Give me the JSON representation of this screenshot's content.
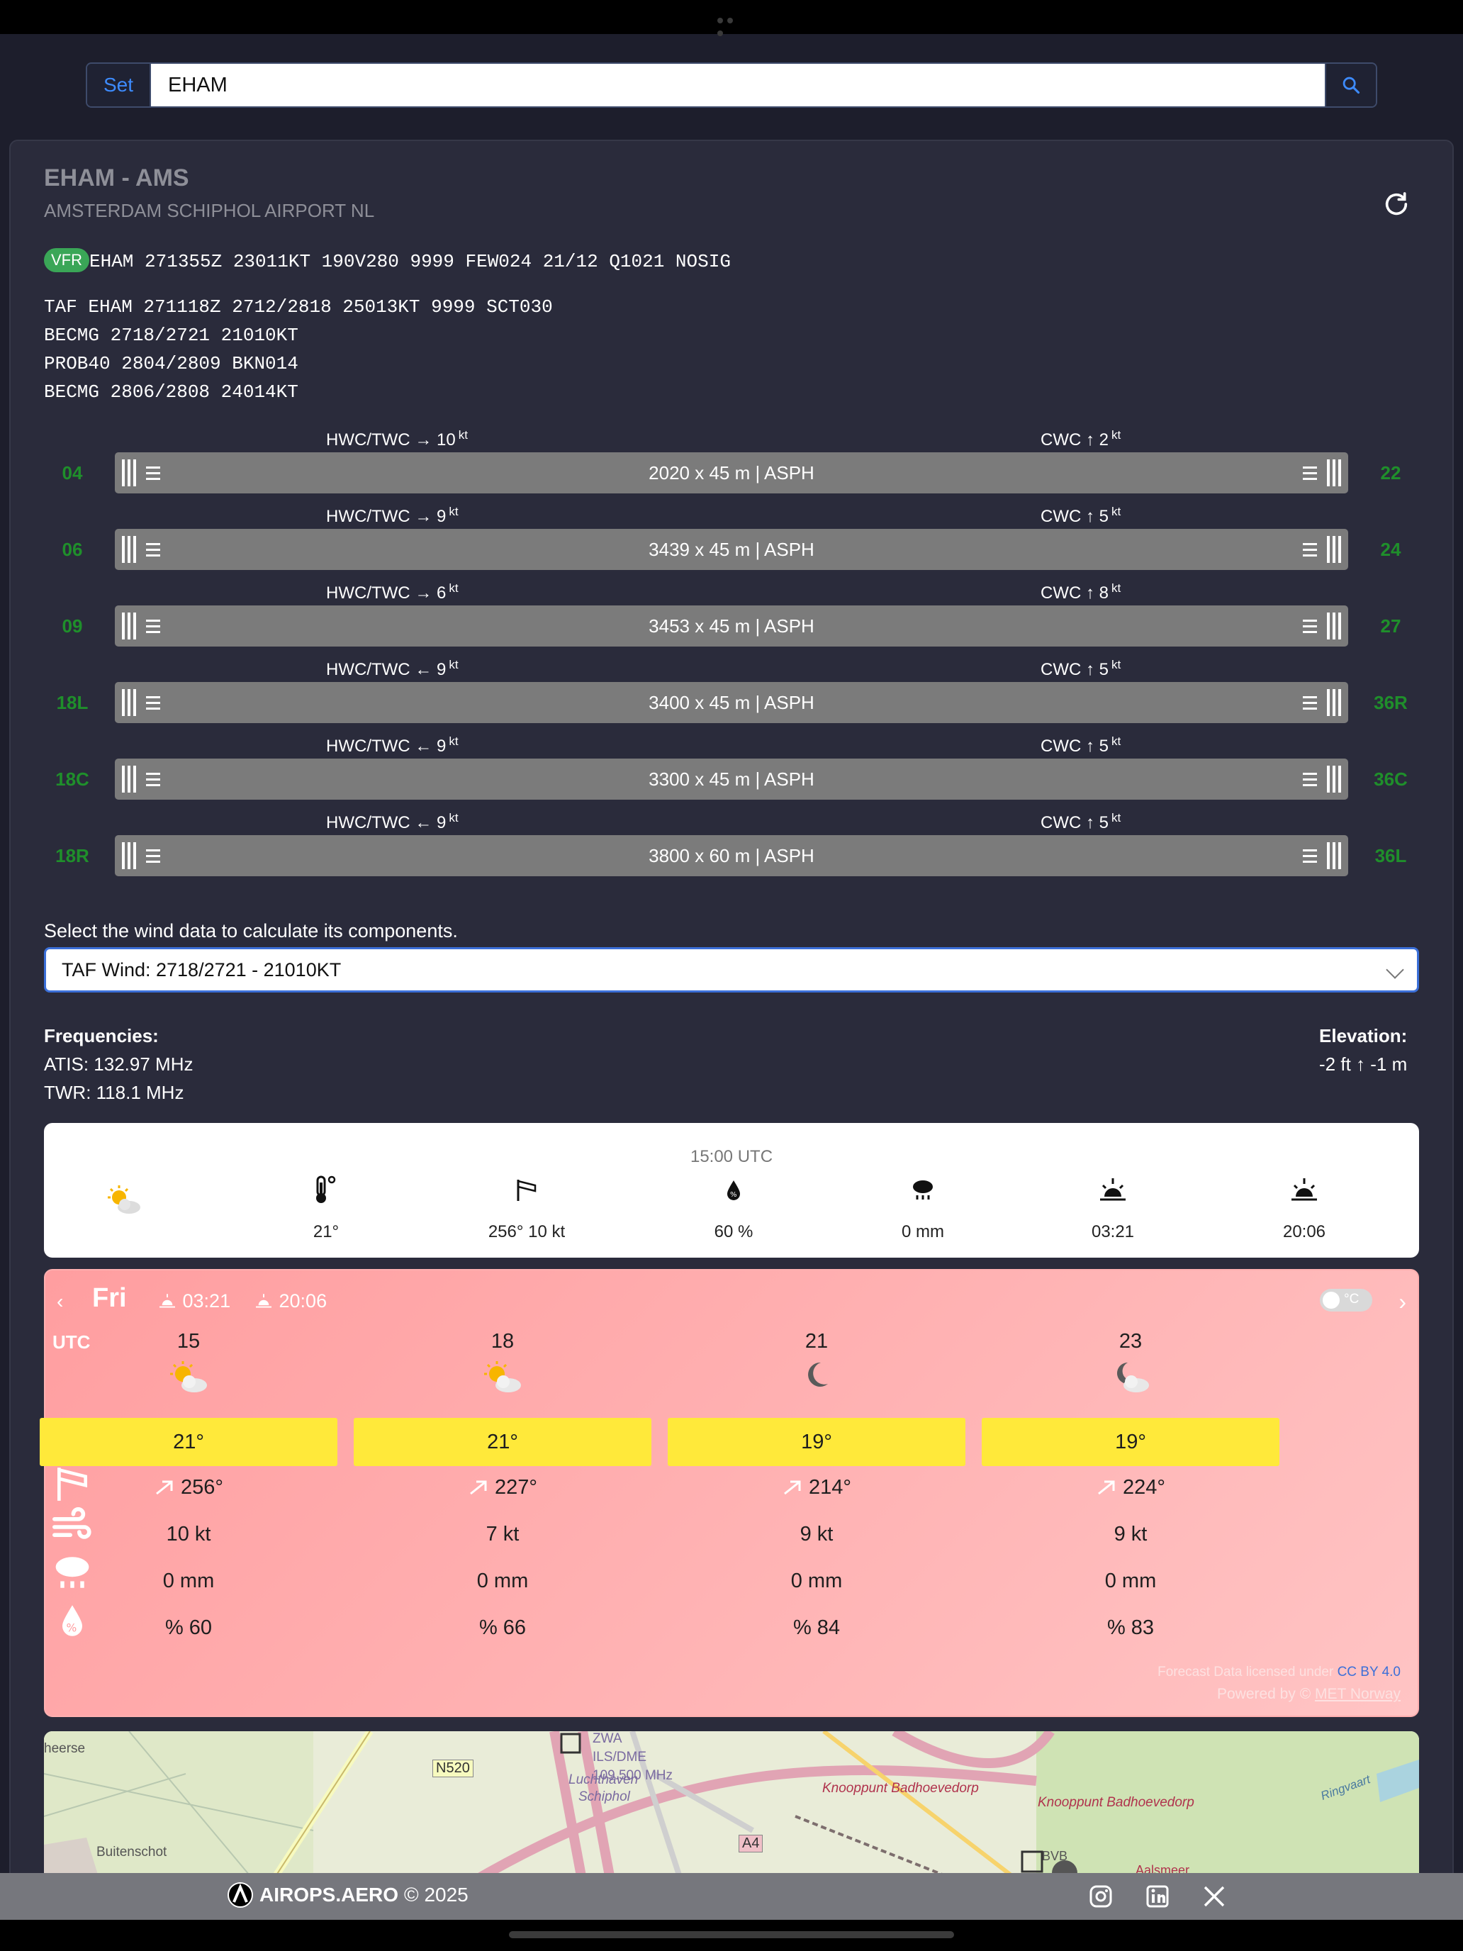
{
  "search": {
    "set_label": "Set",
    "value": "EHAM"
  },
  "airport": {
    "code_title": "EHAM - AMS",
    "name": "AMSTERDAM SCHIPHOL AIRPORT NL"
  },
  "metar": {
    "badge": "VFR",
    "text": "EHAM 271355Z 23011KT 190V280 9999 FEW024 21/12 Q1021 NOSIG"
  },
  "taf": [
    "TAF EHAM 271118Z 2712/2818 25013KT 9999 SCT030",
    "BECMG 2718/2721 21010KT",
    "PROB40 2804/2809 BKN014",
    "BECMG 2806/2808 24014KT"
  ],
  "runways": [
    {
      "left": "04",
      "right": "22",
      "dims": "2020 x 45 m | ASPH",
      "hwc_label": "HWC/TWC",
      "hwc_arrow": "→",
      "hwc": "10",
      "cwc_label": "CWC",
      "cwc_arrow": "↑",
      "cwc": "2",
      "unit": "kt"
    },
    {
      "left": "06",
      "right": "24",
      "dims": "3439 x 45 m | ASPH",
      "hwc_label": "HWC/TWC",
      "hwc_arrow": "→",
      "hwc": "9",
      "cwc_label": "CWC",
      "cwc_arrow": "↑",
      "cwc": "5",
      "unit": "kt"
    },
    {
      "left": "09",
      "right": "27",
      "dims": "3453 x 45 m | ASPH",
      "hwc_label": "HWC/TWC",
      "hwc_arrow": "→",
      "hwc": "6",
      "cwc_label": "CWC",
      "cwc_arrow": "↑",
      "cwc": "8",
      "unit": "kt"
    },
    {
      "left": "18L",
      "right": "36R",
      "dims": "3400 x 45 m | ASPH",
      "hwc_label": "HWC/TWC",
      "hwc_arrow": "←",
      "hwc": "9",
      "cwc_label": "CWC",
      "cwc_arrow": "↑",
      "cwc": "5",
      "unit": "kt"
    },
    {
      "left": "18C",
      "right": "36C",
      "dims": "3300 x 45 m | ASPH",
      "hwc_label": "HWC/TWC",
      "hwc_arrow": "←",
      "hwc": "9",
      "cwc_label": "CWC",
      "cwc_arrow": "↑",
      "cwc": "5",
      "unit": "kt"
    },
    {
      "left": "18R",
      "right": "36L",
      "dims": "3800 x 60 m | ASPH",
      "hwc_label": "HWC/TWC",
      "hwc_arrow": "←",
      "hwc": "9",
      "cwc_label": "CWC",
      "cwc_arrow": "↑",
      "cwc": "5",
      "unit": "kt"
    }
  ],
  "wind_select": {
    "label": "Select the wind data to calculate its components.",
    "value": "TAF Wind: 2718/2721 - 21010KT"
  },
  "frequencies": {
    "title": "Frequencies:",
    "atis": "ATIS: 132.97 MHz",
    "twr": "TWR: 118.1 MHz"
  },
  "elevation": {
    "title": "Elevation:",
    "value": "-2 ft ↑ -1 m"
  },
  "now": {
    "time": "15:00 UTC",
    "temp": "21°",
    "wind": "256° 10 kt",
    "humidity": "60 %",
    "precip": "0 mm",
    "sunrise": "03:21",
    "sunset": "20:06"
  },
  "forecast": {
    "day": "Fri",
    "sunrise": "03:21",
    "sunset": "20:06",
    "unit_toggle": "°C",
    "utc_label": "UTC",
    "columns": [
      {
        "hour": "15",
        "icon": "partly-cloudy-day-icon",
        "temp": "21°",
        "dir": "256°",
        "speed": "10 kt",
        "precip": "0 mm",
        "hum": "% 60"
      },
      {
        "hour": "18",
        "icon": "partly-cloudy-day-icon",
        "temp": "21°",
        "dir": "227°",
        "speed": "7 kt",
        "precip": "0 mm",
        "hum": "% 66"
      },
      {
        "hour": "21",
        "icon": "moon-icon",
        "temp": "19°",
        "dir": "214°",
        "speed": "9 kt",
        "precip": "0 mm",
        "hum": "% 84"
      },
      {
        "hour": "23",
        "icon": "partly-cloudy-night-icon",
        "temp": "19°",
        "dir": "224°",
        "speed": "9 kt",
        "precip": "0 mm",
        "hum": "% 83"
      }
    ],
    "credit_text": "Forecast Data licensed under",
    "credit_license": "CC BY 4.0",
    "powered": "Powered by ©",
    "powered_link": "MET Norway"
  },
  "map_labels": {
    "n520": "N520",
    "a4": "A4",
    "zwa": "ZWA",
    "ils": "ILS/DME",
    "freq": "109.500 MHz",
    "lucht": "Luchthaven",
    "schiphol": "Schiphol",
    "knoop1": "Knooppunt Badhoevedorp",
    "knoop2": "Knooppunt Badhoevedorp",
    "buitenschot": "Buitenschot",
    "bvb": "BVB",
    "aalsmeer": "Aalsmeer",
    "heerse": "heerse",
    "ringvaart": "Ringvaart"
  },
  "footer": {
    "brand": "AIROPS.AERO",
    "copyright": "© 2025"
  },
  "colors": {
    "background": "#1d1e2c",
    "runway": "#7b7b7b",
    "runway_label": "#1f8f2b",
    "vfr": "#3aa657",
    "accent": "#3d8bfd",
    "temp_box": "#ffe93a"
  }
}
